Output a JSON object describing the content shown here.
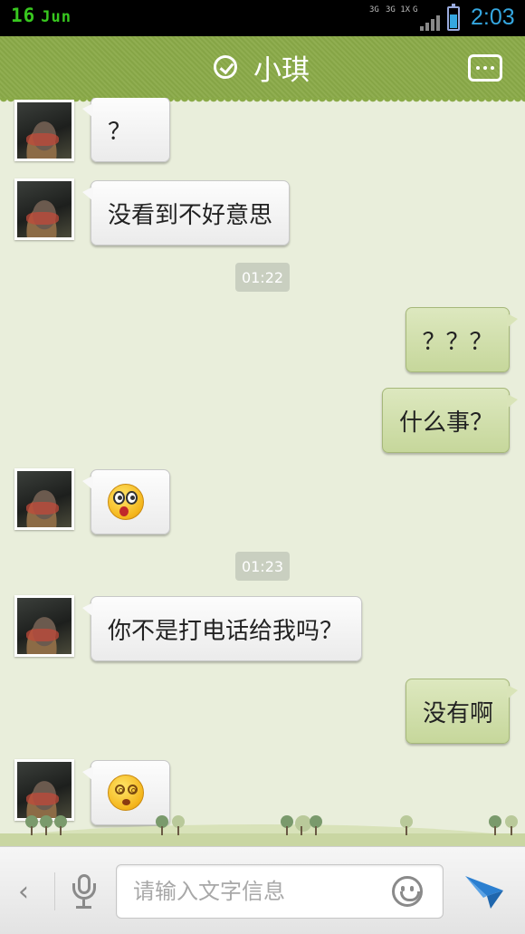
{
  "status_bar": {
    "day": "16",
    "month": "Jun",
    "network_labels": [
      "3G",
      "3G 1X",
      "G"
    ],
    "time": "2:03",
    "battery_level": 0.7,
    "accent_color": "#35a7e0"
  },
  "header": {
    "title": "小琪",
    "status_icon": "check-circle-icon",
    "menu_icon": "more-dots-icon",
    "color": "#8aaa48"
  },
  "messages": [
    {
      "side": "in",
      "type": "text",
      "text": "？"
    },
    {
      "side": "in",
      "type": "text",
      "text": "没看到不好意思"
    },
    {
      "type": "time",
      "text": "01:22"
    },
    {
      "side": "out",
      "type": "text",
      "text": "？？？"
    },
    {
      "side": "out",
      "type": "text",
      "text": "什么事？"
    },
    {
      "side": "in",
      "type": "emoji",
      "emoji": "surprised-emoji-icon"
    },
    {
      "type": "time",
      "text": "01:23"
    },
    {
      "side": "in",
      "type": "text",
      "text": "你不是打电话给我吗？"
    },
    {
      "side": "out",
      "type": "text",
      "text": "没有啊"
    },
    {
      "side": "in",
      "type": "emoji",
      "emoji": "dizzy-emoji-icon"
    }
  ],
  "input_bar": {
    "back_icon": "chevron-left-icon",
    "back_glyph": "‹",
    "voice_icon": "microphone-icon",
    "placeholder": "请输入文字信息",
    "value": "",
    "emoji_icon": "smiley-icon",
    "send_icon": "send-arrow-icon",
    "send_color": "#2b7fd0"
  }
}
